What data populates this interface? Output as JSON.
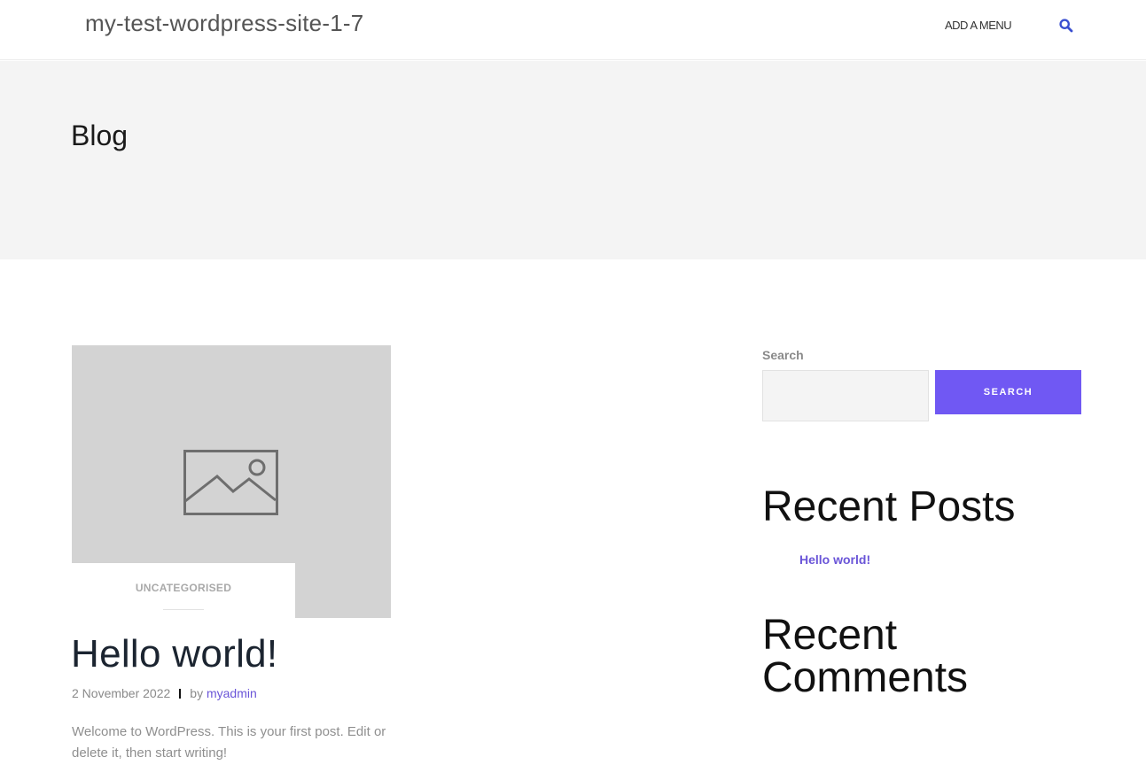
{
  "header": {
    "site_title": "my-test-wordpress-site-1-7",
    "menu_label": "ADD A MENU",
    "search_icon": "search-icon",
    "accent_color": "#3a4fd0"
  },
  "title_band": {
    "title": "Blog"
  },
  "post": {
    "thumbnail_icon": "image-placeholder-icon",
    "category": "UNCATEGORISED",
    "title": "Hello world!",
    "date": "2 November 2022",
    "by_label": "by",
    "author": "myadmin",
    "excerpt": "Welcome to WordPress. This is your first post. Edit or delete it, then start writing!"
  },
  "sidebar": {
    "search": {
      "label": "Search",
      "value": "",
      "button_label": "SEARCH"
    },
    "recent_posts": {
      "title": "Recent Posts",
      "items": [
        "Hello world!"
      ]
    },
    "recent_comments": {
      "title": "Recent Comments"
    }
  },
  "colors": {
    "button": "#7058f3",
    "link": "#6a55d8",
    "band": "#f4f4f4",
    "thumbnail": "#d3d3d3"
  }
}
